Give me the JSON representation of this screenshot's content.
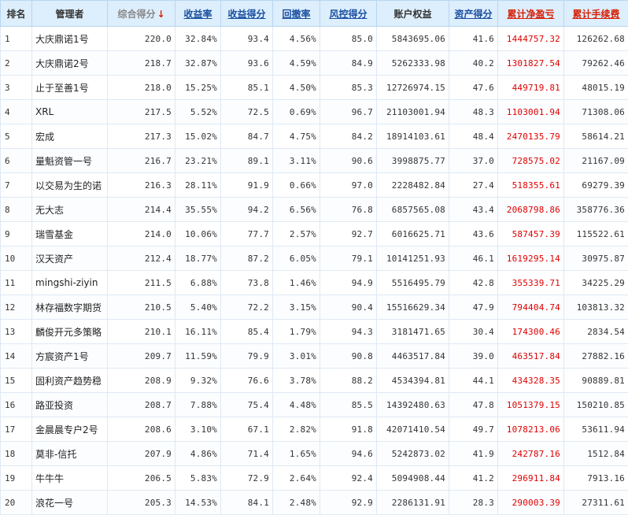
{
  "headers": [
    {
      "label": "排名",
      "style": "plain"
    },
    {
      "label": "管理者",
      "style": "plain"
    },
    {
      "label": "综合得分",
      "style": "muted",
      "arrow": "↓"
    },
    {
      "label": "收益率",
      "style": "link"
    },
    {
      "label": "收益得分",
      "style": "link"
    },
    {
      "label": "回撤率",
      "style": "link"
    },
    {
      "label": "风控得分",
      "style": "link"
    },
    {
      "label": "账户权益",
      "style": "plain"
    },
    {
      "label": "资产得分",
      "style": "link"
    },
    {
      "label": "累计净盈亏",
      "style": "red"
    },
    {
      "label": "累计手续费",
      "style": "red"
    }
  ],
  "rows": [
    [
      "1",
      "大庆鼎诺1号",
      "220.0",
      "32.84%",
      "93.4",
      "4.56%",
      "85.0",
      "5843695.06",
      "41.6",
      "1444757.32",
      "126262.68"
    ],
    [
      "2",
      "大庆鼎诺2号",
      "218.7",
      "32.87%",
      "93.6",
      "4.59%",
      "84.9",
      "5262333.98",
      "40.2",
      "1301827.54",
      "79262.46"
    ],
    [
      "3",
      "止于至善1号",
      "218.0",
      "15.25%",
      "85.1",
      "4.50%",
      "85.3",
      "12726974.15",
      "47.6",
      "449719.81",
      "48015.19"
    ],
    [
      "4",
      "XRL",
      "217.5",
      "5.52%",
      "72.5",
      "0.69%",
      "96.7",
      "21103001.94",
      "48.3",
      "1103001.94",
      "71308.06"
    ],
    [
      "5",
      "宏成",
      "217.3",
      "15.02%",
      "84.7",
      "4.75%",
      "84.2",
      "18914103.61",
      "48.4",
      "2470135.79",
      "58614.21"
    ],
    [
      "6",
      "量魁资管一号",
      "216.7",
      "23.21%",
      "89.1",
      "3.11%",
      "90.6",
      "3998875.77",
      "37.0",
      "728575.02",
      "21167.09"
    ],
    [
      "7",
      "以交易为生的诺",
      "216.3",
      "28.11%",
      "91.9",
      "0.66%",
      "97.0",
      "2228482.84",
      "27.4",
      "518355.61",
      "69279.39"
    ],
    [
      "8",
      "无大志",
      "214.4",
      "35.55%",
      "94.2",
      "6.56%",
      "76.8",
      "6857565.08",
      "43.4",
      "2068798.86",
      "358776.36"
    ],
    [
      "9",
      "瑞雪基金",
      "214.0",
      "10.06%",
      "77.7",
      "2.57%",
      "92.7",
      "6016625.71",
      "43.6",
      "587457.39",
      "115522.61"
    ],
    [
      "10",
      "汉天资产",
      "212.4",
      "18.77%",
      "87.2",
      "6.05%",
      "79.1",
      "10141251.93",
      "46.1",
      "1619295.14",
      "30975.87"
    ],
    [
      "11",
      "mingshi-ziyin",
      "211.5",
      "6.88%",
      "73.8",
      "1.46%",
      "94.9",
      "5516495.79",
      "42.8",
      "355339.71",
      "34225.29"
    ],
    [
      "12",
      "林存福数字期货",
      "210.5",
      "5.40%",
      "72.2",
      "3.15%",
      "90.4",
      "15516629.34",
      "47.9",
      "794404.74",
      "103813.32"
    ],
    [
      "13",
      "麟俊开元多策略",
      "210.1",
      "16.11%",
      "85.4",
      "1.79%",
      "94.3",
      "3181471.65",
      "30.4",
      "174300.46",
      "2834.54"
    ],
    [
      "14",
      "方宸资产1号",
      "209.7",
      "11.59%",
      "79.9",
      "3.01%",
      "90.8",
      "4463517.84",
      "39.0",
      "463517.84",
      "27882.16"
    ],
    [
      "15",
      "固利资产趋势稳",
      "208.9",
      "9.32%",
      "76.6",
      "3.78%",
      "88.2",
      "4534394.81",
      "44.1",
      "434328.35",
      "90889.81"
    ],
    [
      "16",
      "路亚投资",
      "208.7",
      "7.88%",
      "75.4",
      "4.48%",
      "85.5",
      "14392480.63",
      "47.8",
      "1051379.15",
      "150210.85"
    ],
    [
      "17",
      "金晨晨专户2号",
      "208.6",
      "3.10%",
      "67.1",
      "2.82%",
      "91.8",
      "42071410.54",
      "49.7",
      "1078213.06",
      "53611.94"
    ],
    [
      "18",
      "莫非-信托",
      "207.9",
      "4.86%",
      "71.4",
      "1.65%",
      "94.6",
      "5242873.02",
      "41.9",
      "242787.16",
      "1512.84"
    ],
    [
      "19",
      "牛牛牛",
      "206.5",
      "5.83%",
      "72.9",
      "2.64%",
      "92.4",
      "5094908.44",
      "41.2",
      "296911.84",
      "7913.16"
    ],
    [
      "20",
      "浪花一号",
      "205.3",
      "14.53%",
      "84.1",
      "2.48%",
      "92.9",
      "2286131.91",
      "28.3",
      "290003.39",
      "27311.61"
    ]
  ],
  "colors": {
    "header_bg": "#ddeefc",
    "header_link": "#1a4fa0",
    "accent_red": "#d81e06",
    "value_red": "#e00000",
    "border": "#dfe9f3"
  }
}
